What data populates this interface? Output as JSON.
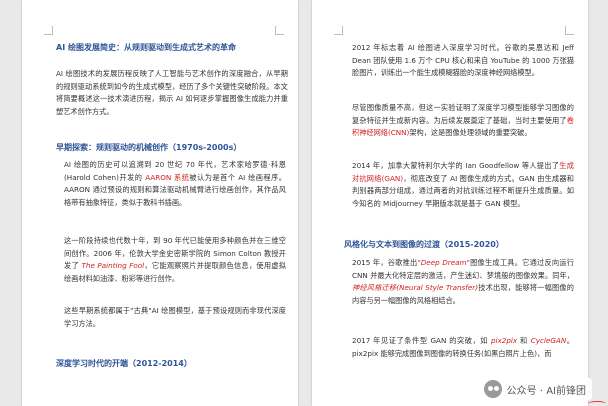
{
  "left_page": {
    "title": "AI 绘图发展简史：从规则驱动到生成式艺术的革命",
    "intro": "AI 绘图技术的发展历程反映了人工智能与艺术创作的深度融合，从早期的规则驱动系统到如今的生成式模型，经历了多个关键性突破阶段。本文将简要概述这一技术演进历程，揭示 AI 如何逐步掌握图像生成能力并重塑艺术创作方式。",
    "h_early": "早期探索：规则驱动的机械创作（1970s-2000s）",
    "p_aaron_a": "AI 绘图的历史可以追溯到 20 世纪 70 年代，艺术家哈罗德·科恩(Harold Cohen)开发的 ",
    "p_aaron_red": "AARON 系统",
    "p_aaron_b": "被认为是首个 AI 绘画程序。AARON 通过预设的规则和算法驱动机械臂进行绘画创作，其作品风格带有抽象特征，类似于教科书插画。",
    "p_fool_a": "这一阶段持续也代数十年，到 90 年代已能使用多种颜色并在三维空间创作。2006 年，伦敦大学金史密斯学院的 Simon Colton 教授开发了 ",
    "p_fool_red": "The Painting Fool",
    "p_fool_b": "，它能观察照片并提取颜色信息，使用虚拟绘画材料如油漆、粉彩等进行创作。",
    "p_rule": "这些早期系统都属于\"古典\"AI 绘图模型，基于预设规则而非现代深度学习方法。",
    "h_deep": "深度学习时代的开端（2012-2014）"
  },
  "right_page": {
    "p_2012": "2012 年标志着 AI 绘图进入深度学习时代。谷歌的吴恩达和 Jeff Dean 团队使用 1.6 万个 CPU 核心和来自 YouTube 的 1000 万张猫脸图片，训练出一个能生成模糊猫脸的深度神经网络模型。",
    "p_cnn_a": "尽管图像质量不高，但这一实验证明了深度学习模型能够学习图像的复杂特征并生成新内容。为后续发展奠定了基础，当时主要使用了",
    "p_cnn_red": "卷积神经网络(CNN)",
    "p_cnn_b": "架构，这是图像处理领域的重要突破。",
    "p_gan_a": "2014 年，加拿大蒙特利尔大学的 Ian Goodfellow 等人提出了",
    "p_gan_red": "生成对抗网络(GAN)",
    "p_gan_b": "，彻底改变了 AI 图像生成的方式。GAN 由生成器和判别器两部分组成，通过两者的对抗训练过程不断提升生成质量。如今知名的 Midjourney 早期版本就是基于 GAN 模型。",
    "h_style": "风格化与文本到图像的过渡（2015-2020）",
    "p_dd_a": "2015 年，谷歌推出",
    "p_dd_red": "\"Deep Dream\"",
    "p_dd_b": "图像生成工具。它通过反向运行 CNN 并最大化特定层的激活，产生迷幻、梦境般的图像效果。同年，",
    "p_dd_red2": "神经风格迁移(Neural Style Transfer)",
    "p_dd_c": "技术出现，能够将一幅图像的内容与另一幅图像的风格相结合。",
    "p_p2p_a": "2017 年见证了条件型 GAN 的突破，如 ",
    "p_p2p_red": "pix2pix",
    "p_p2p_mid": " 和 ",
    "p_p2p_red2": "CycleGAN",
    "p_p2p_b": "。pix2pix 能够完成图像到图像的转换任务(如黑白照片上色)，而"
  },
  "watermark": {
    "text": "公众号 · AI前锋团"
  }
}
